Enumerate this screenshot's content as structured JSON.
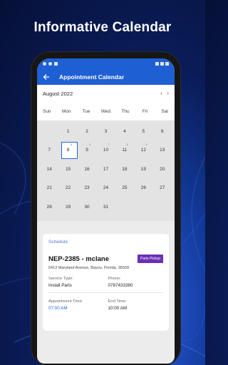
{
  "headline": "Informative Calendar",
  "appbar": {
    "title": "Appointment Calendar"
  },
  "calendar": {
    "month_label": "August 2022",
    "prev_label": "‹",
    "next_label": "›",
    "weekdays": [
      "Sun",
      "Mon",
      "Tue",
      "Wed",
      "Thu",
      "Fri",
      "Sat"
    ],
    "days": [
      {
        "n": "",
        "c": ""
      },
      {
        "n": "1",
        "c": ""
      },
      {
        "n": "2",
        "c": ""
      },
      {
        "n": "3",
        "c": ""
      },
      {
        "n": "4",
        "c": ""
      },
      {
        "n": "5",
        "c": ""
      },
      {
        "n": "6",
        "c": ""
      },
      {
        "n": "7",
        "c": ""
      },
      {
        "n": "8",
        "c": "3",
        "sel": true
      },
      {
        "n": "9",
        "c": "1"
      },
      {
        "n": "10",
        "c": "7"
      },
      {
        "n": "11",
        "c": "2"
      },
      {
        "n": "12",
        "c": "1"
      },
      {
        "n": "13",
        "c": ""
      },
      {
        "n": "14",
        "c": ""
      },
      {
        "n": "15",
        "c": ""
      },
      {
        "n": "16",
        "c": ""
      },
      {
        "n": "17",
        "c": ""
      },
      {
        "n": "18",
        "c": ""
      },
      {
        "n": "19",
        "c": ""
      },
      {
        "n": "20",
        "c": ""
      },
      {
        "n": "21",
        "c": ""
      },
      {
        "n": "22",
        "c": ""
      },
      {
        "n": "23",
        "c": ""
      },
      {
        "n": "24",
        "c": ""
      },
      {
        "n": "25",
        "c": ""
      },
      {
        "n": "26",
        "c": ""
      },
      {
        "n": "27",
        "c": ""
      },
      {
        "n": "28",
        "c": ""
      },
      {
        "n": "29",
        "c": ""
      },
      {
        "n": "30",
        "c": ""
      },
      {
        "n": "31",
        "c": ""
      },
      {
        "n": "",
        "c": ""
      },
      {
        "n": "",
        "c": ""
      },
      {
        "n": "",
        "c": ""
      }
    ]
  },
  "schedule": {
    "section_label": "Schedule",
    "order_title": "NEP-2385 - mclane",
    "badge": "Parts Pickup",
    "address": "5413 Maryland Avenue, Bayou, Florida, 36509",
    "service_type_label": "Service Type:",
    "service_type_value": "Install Parts",
    "phone_label": "Phone:",
    "phone_value": "0787433380",
    "appointment_time_label": "Appointment Time:",
    "appointment_time_value": "07:00 AM",
    "end_time_label": "End Time:",
    "end_time_value": "10:00 AM"
  },
  "colors": {
    "primary": "#1f5fd4",
    "badge": "#6a2fb5",
    "link": "#2a64d8"
  }
}
